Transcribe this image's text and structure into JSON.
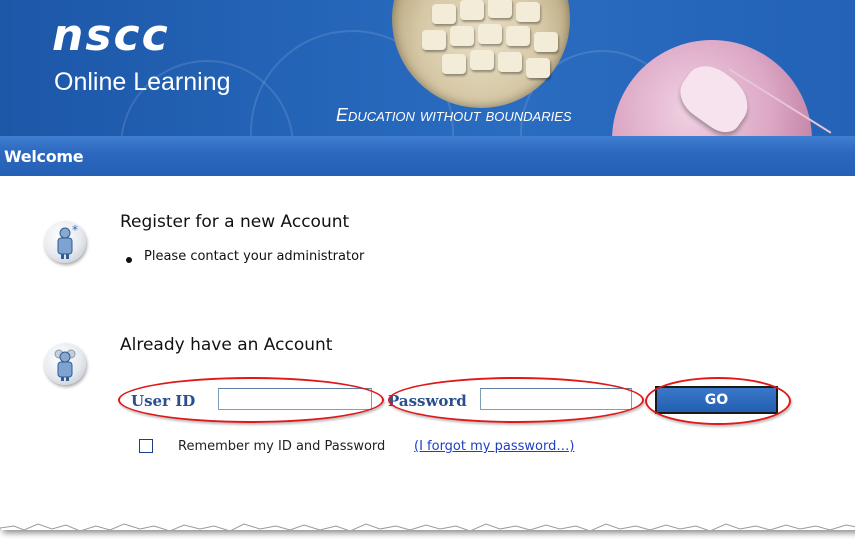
{
  "banner": {
    "logo_main": "nscc",
    "logo_sub": "Online Learning",
    "tagline": "Education without boundaries"
  },
  "welcome": {
    "title": "Welcome"
  },
  "register": {
    "title": "Register for a new Account",
    "bullet": "Please contact your administrator",
    "icon": "new-user-icon"
  },
  "login": {
    "title": "Already have an Account",
    "icon": "users-icon",
    "user_id_label": "User ID",
    "user_id_value": "",
    "password_label": "Password",
    "password_value": "",
    "go_label": "GO",
    "remember_label": "Remember my ID and Password",
    "remember_checked": false,
    "forgot_link": "(I forgot my password…)"
  },
  "colors": {
    "banner_blue": "#2566b9",
    "label_blue": "#2a4f8f",
    "annotation_red": "#e01818",
    "link_blue": "#1e3fc4"
  }
}
